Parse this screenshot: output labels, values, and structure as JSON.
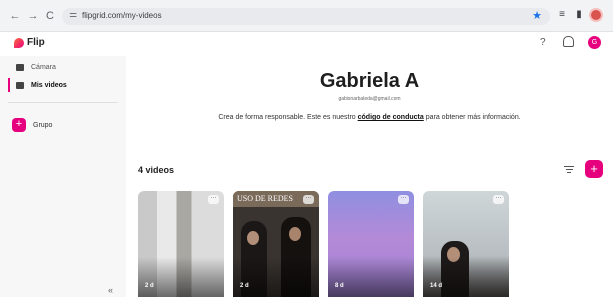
{
  "browser": {
    "url": "flipgrid.com/my-videos",
    "back": "←",
    "forward": "→",
    "reload": "C"
  },
  "app": {
    "brand": "Flip",
    "help": "?",
    "avatar_initial": "G"
  },
  "sidebar": {
    "items": [
      {
        "label": "Cámara",
        "icon": "camera-icon",
        "active": false
      },
      {
        "label": "Mis videos",
        "icon": "videos-icon",
        "active": true
      }
    ],
    "group_button": "+",
    "group_label": "Grupo",
    "collapse": "«"
  },
  "profile": {
    "name": "Gabriela A",
    "email": "gabisnarbaleda@gmail.com",
    "notice_before": "Crea de forma responsable. Este es nuestro",
    "notice_link": "código de conducta",
    "notice_after": "para obtener más información."
  },
  "videos": {
    "count_label": "4 videos",
    "add": "+",
    "items": [
      {
        "duration": "2 d",
        "more": "···"
      },
      {
        "duration": "2 d",
        "more": "···",
        "banner": "USO DE REDES"
      },
      {
        "duration": "8 d",
        "more": "···"
      },
      {
        "duration": "14 d",
        "more": "···"
      }
    ]
  },
  "colors": {
    "accent": "#e6007e",
    "sidebar_bg": "#f7f7f7",
    "link_blue": "#1a73e8"
  }
}
